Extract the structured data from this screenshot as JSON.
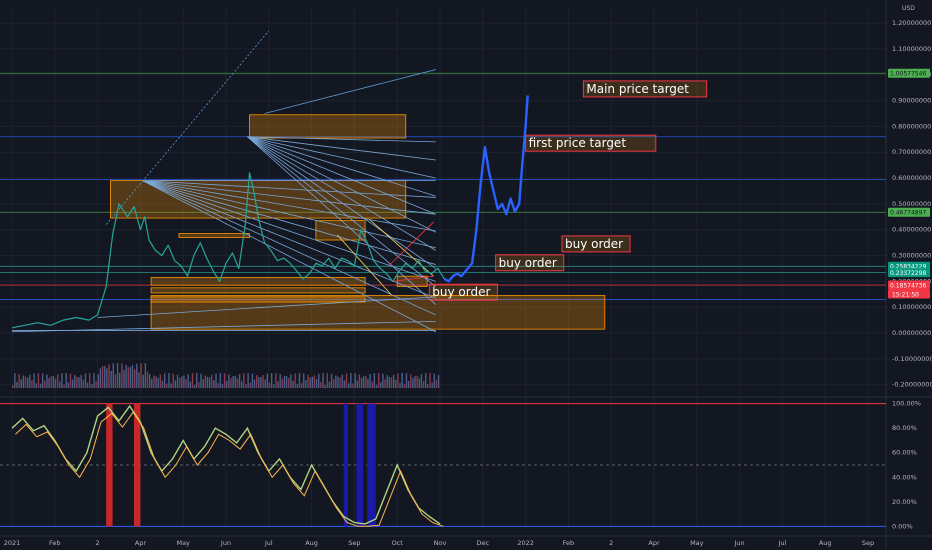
{
  "chart_data": {
    "type": "line",
    "currency": "USD",
    "price_axis": {
      "ticks": [
        1.2,
        1.1,
        1.0,
        0.9,
        0.8,
        0.7,
        0.6,
        0.5,
        0.4,
        0.3,
        0.2,
        0.1,
        0.0,
        -0.1,
        -0.2
      ],
      "tick_labels": [
        "1.20000000",
        "1.10000000",
        "1.00000000",
        "0.90000000",
        "0.80000000",
        "0.70000000",
        "0.60000000",
        "0.50000000",
        "0.40000000",
        "0.30000000",
        "0.20000000",
        "0.10000000",
        "0.00000000",
        "-0.10000000",
        "-0.20000000"
      ],
      "range": [
        -0.24,
        1.27
      ]
    },
    "oscillator_axis": {
      "ticks": [
        100,
        80,
        60,
        40,
        20,
        0
      ],
      "tick_labels": [
        "100.00%",
        "80.00%",
        "60.00%",
        "40.00%",
        "20.00%",
        "0.00%"
      ],
      "range": [
        -3,
        103
      ]
    },
    "time_axis": {
      "labels": [
        "2021",
        "Feb",
        "2",
        "Apr",
        "May",
        "Jun",
        "Jul",
        "Aug",
        "Sep",
        "Oct",
        "Nov",
        "Dec",
        "2022",
        "Feb",
        "2",
        "Apr",
        "May",
        "Jun",
        "Jul",
        "Aug",
        "Sep"
      ]
    },
    "badges": [
      {
        "label": "1.00577546",
        "value": 1.0058,
        "color": "#4caf50",
        "text_color": "#131722"
      },
      {
        "label": "0.46774897",
        "value": 0.4677,
        "color": "#4caf50",
        "text_color": "#131722"
      },
      {
        "label": "0.25834229",
        "value": 0.2583,
        "color": "#089981",
        "text_color": "#ffffff"
      },
      {
        "label": "0.23372298",
        "value": 0.2337,
        "color": "#089981",
        "text_color": "#ffffff"
      },
      {
        "label": "0.18574736",
        "value": 0.1857,
        "color": "#f23645",
        "text_color": "#ffffff"
      }
    ],
    "countdown": "15:21:50",
    "horizontal_lines": [
      {
        "value": 1.0058,
        "color": "#4caf50"
      },
      {
        "value": 0.4677,
        "color": "#4caf50"
      },
      {
        "value": 0.2583,
        "color": "#26a69a"
      },
      {
        "value": 0.2337,
        "color": "#26a69a"
      },
      {
        "value": 0.1857,
        "color": "#f23645"
      },
      {
        "value": 0.76,
        "color": "#2962ff"
      },
      {
        "value": 0.595,
        "color": "#2962ff"
      },
      {
        "value": 0.13,
        "color": "#2962ff"
      }
    ],
    "zones": [
      {
        "t0": 5.55,
        "t1": 9.2,
        "p_top": 0.845,
        "p_bot": 0.755
      },
      {
        "t0": 2.3,
        "t1": 9.2,
        "p_top": 0.59,
        "p_bot": 0.445
      },
      {
        "t0": 3.9,
        "t1": 5.55,
        "p_top": 0.385,
        "p_bot": 0.37
      },
      {
        "t0": 7.1,
        "t1": 8.25,
        "p_top": 0.435,
        "p_bot": 0.36
      },
      {
        "t0": 3.25,
        "t1": 8.25,
        "p_top": 0.215,
        "p_bot": 0.185
      },
      {
        "t0": 3.25,
        "t1": 8.25,
        "p_top": 0.175,
        "p_bot": 0.155
      },
      {
        "t0": 3.25,
        "t1": 8.25,
        "p_top": 0.14,
        "p_bot": 0.12
      },
      {
        "t0": 9.0,
        "t1": 9.7,
        "p_top": 0.22,
        "p_bot": 0.18
      },
      {
        "t0": 3.25,
        "t1": 13.85,
        "p_top": 0.145,
        "p_bot": 0.015
      }
    ],
    "annotations": [
      {
        "text": "Main price target",
        "t": 13.35,
        "p": 0.945
      },
      {
        "text": "first price target",
        "t": 12.0,
        "p": 0.735
      },
      {
        "text": "buy order",
        "t": 12.85,
        "p": 0.345
      },
      {
        "text": "buy order",
        "t": 11.3,
        "p": 0.272
      },
      {
        "text": "buy order",
        "t": 9.75,
        "p": 0.158
      }
    ],
    "series": [
      {
        "name": "",
        "color": "#26a69a",
        "x": [
          0,
          0.3,
          0.6,
          0.9,
          1.2,
          1.5,
          1.8,
          2.0,
          2.2,
          2.35,
          2.5,
          2.7,
          2.85,
          3.0,
          3.1,
          3.2,
          3.35,
          3.5,
          3.65,
          3.8,
          3.95,
          4.1,
          4.25,
          4.4,
          4.55,
          4.7,
          4.85,
          5.0,
          5.15,
          5.3,
          5.45,
          5.55,
          5.65,
          5.75,
          5.9,
          6.05,
          6.2,
          6.35,
          6.5,
          6.65,
          6.8,
          6.95,
          7.1,
          7.25,
          7.4,
          7.55,
          7.7,
          7.85,
          8.0,
          8.15,
          8.3,
          8.45,
          8.6,
          8.75,
          8.9,
          9.05,
          9.2,
          9.35,
          9.5,
          9.65,
          9.8,
          9.95,
          10.1
        ],
        "y": [
          0.02,
          0.03,
          0.04,
          0.03,
          0.05,
          0.06,
          0.05,
          0.07,
          0.18,
          0.38,
          0.5,
          0.45,
          0.49,
          0.4,
          0.45,
          0.36,
          0.32,
          0.3,
          0.34,
          0.28,
          0.26,
          0.22,
          0.3,
          0.35,
          0.29,
          0.24,
          0.2,
          0.27,
          0.31,
          0.25,
          0.42,
          0.62,
          0.55,
          0.45,
          0.35,
          0.32,
          0.28,
          0.29,
          0.27,
          0.24,
          0.21,
          0.23,
          0.27,
          0.26,
          0.29,
          0.25,
          0.29,
          0.28,
          0.26,
          0.4,
          0.35,
          0.28,
          0.25,
          0.23,
          0.2,
          0.24,
          0.27,
          0.25,
          0.28,
          0.24,
          0.23,
          0.25,
          0.21
        ]
      },
      {
        "name": "",
        "color": "#2962ff",
        "x": [
          10.1,
          10.2,
          10.3,
          10.4,
          10.5,
          10.6,
          10.75,
          10.85,
          10.95,
          11.05,
          11.15,
          11.25,
          11.35,
          11.45,
          11.55,
          11.65,
          11.75,
          11.85,
          11.92,
          12.0,
          12.05
        ],
        "y": [
          0.21,
          0.2,
          0.22,
          0.23,
          0.22,
          0.24,
          0.27,
          0.4,
          0.58,
          0.72,
          0.62,
          0.55,
          0.48,
          0.5,
          0.46,
          0.52,
          0.47,
          0.5,
          0.65,
          0.8,
          0.92
        ]
      }
    ],
    "oscillator": {
      "x": [
        0,
        0.25,
        0.5,
        0.75,
        1.0,
        1.25,
        1.5,
        1.75,
        2.0,
        2.25,
        2.5,
        2.75,
        3.0,
        3.25,
        3.5,
        3.75,
        4.0,
        4.25,
        4.5,
        4.75,
        5.0,
        5.25,
        5.5,
        5.75,
        6.0,
        6.25,
        6.5,
        6.75,
        7.0,
        7.25,
        7.5,
        7.75,
        8.0,
        8.25,
        8.5,
        8.75,
        9.0,
        9.25,
        9.5,
        9.75,
        10.0
      ],
      "y": [
        80,
        88,
        78,
        82,
        70,
        55,
        45,
        60,
        90,
        97,
        86,
        98,
        85,
        60,
        45,
        55,
        70,
        55,
        65,
        80,
        75,
        68,
        80,
        60,
        45,
        55,
        40,
        30,
        50,
        35,
        20,
        8,
        3,
        2,
        6,
        28,
        50,
        30,
        15,
        8,
        2
      ],
      "buy_bars_red": [
        [
          2.2,
          2.35
        ],
        [
          2.85,
          3.0
        ]
      ],
      "sell_bars_blue": [
        [
          7.75,
          7.85
        ],
        [
          8.05,
          8.2
        ],
        [
          8.3,
          8.5
        ]
      ]
    }
  }
}
